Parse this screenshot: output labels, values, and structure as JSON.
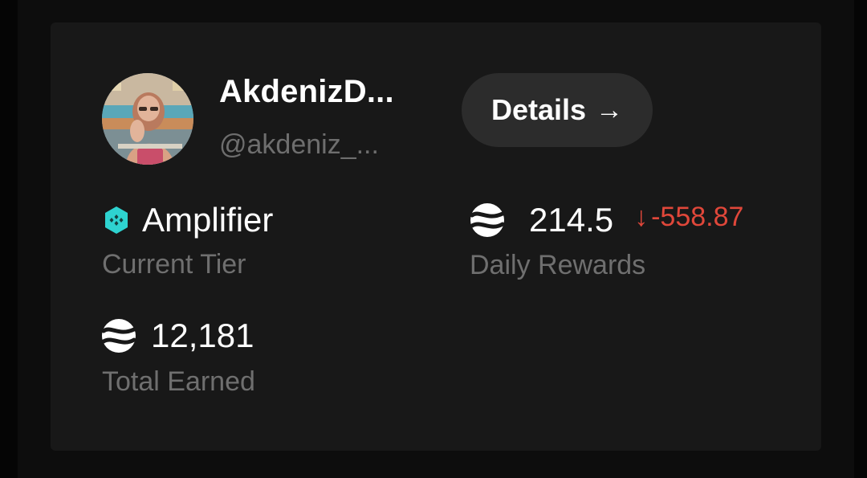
{
  "profile": {
    "display_name": "AkdenizD...",
    "handle": "@akdeniz_...",
    "avatar_icon": "user-avatar-photo"
  },
  "details_button": {
    "label": "Details",
    "arrow": "→"
  },
  "tier": {
    "value": "Amplifier",
    "label": "Current Tier",
    "icon": "hexagon-tier-icon",
    "icon_color": "#2ed3d0"
  },
  "daily_rewards": {
    "value": "214.5",
    "label": "Daily Rewards",
    "change_arrow": "↓",
    "change": "-558.87",
    "change_color": "#e0473a",
    "icon": "token-icon"
  },
  "total_earned": {
    "value": "12,181",
    "label": "Total Earned",
    "icon": "token-icon"
  }
}
